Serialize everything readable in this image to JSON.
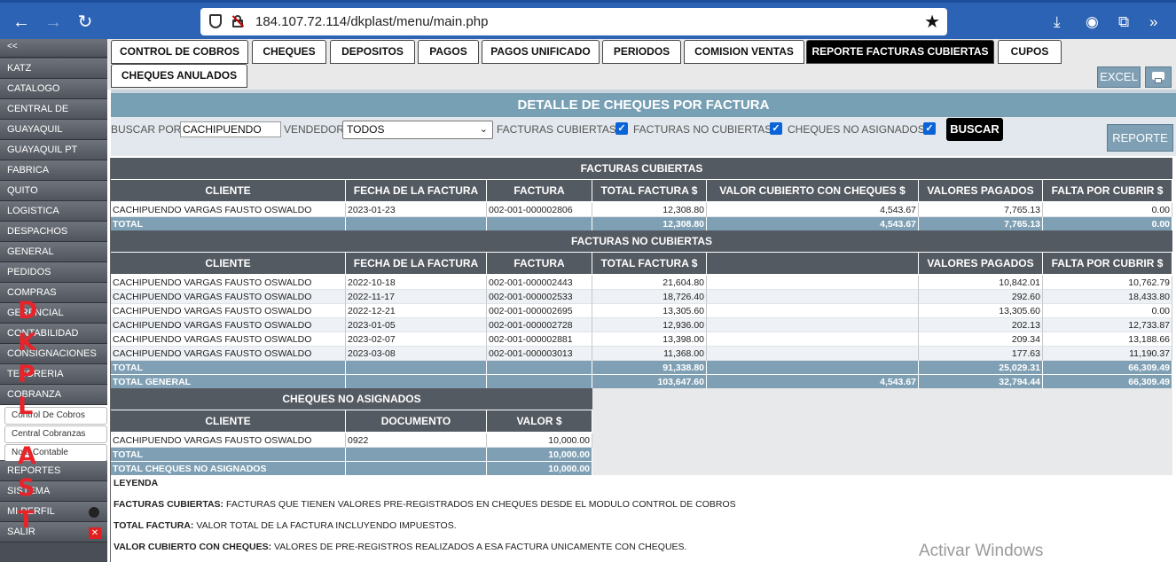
{
  "browser": {
    "url": "184.107.72.114/dkplast/menu/main.php"
  },
  "sidebar": {
    "collapse_label": "<<",
    "items": [
      "KATZ",
      "CATALOGO",
      "CENTRAL DE COSTOS",
      "GUAYAQUIL",
      "GUAYAQUIL PT",
      "FABRICA",
      "QUITO",
      "LOGISTICA",
      "DESPACHOS",
      "GENERAL",
      "PEDIDOS",
      "COMPRAS",
      "GERENCIAL",
      "CONTABILIDAD",
      "CONSIGNACIONES",
      "TESORERIA",
      "COBRANZA"
    ],
    "sub_items": [
      "Control De Cobros",
      "Central Cobranzas",
      "Nota Contable"
    ],
    "bottom_items": [
      "REPORTES",
      "SISTEMA",
      "MI PERFIL",
      "SALIR"
    ],
    "logo_letters": [
      "D",
      "K",
      "P",
      "L",
      "A",
      "S",
      "T"
    ]
  },
  "tabs": [
    "CONTROL DE COBROS",
    "CHEQUES",
    "DEPOSITOS",
    "PAGOS",
    "PAGOS UNIFICADO",
    "PERIODOS",
    "COMISION VENTAS",
    "REPORTE FACTURAS CUBIERTAS",
    "CUPOS",
    "CHEQUES ANULADOS"
  ],
  "toolbar": {
    "excel_label": "EXCEL"
  },
  "page_title": "DETALLE DE CHEQUES POR FACTURA",
  "filters": {
    "buscar_por_label": "BUSCAR POR:",
    "buscar_por_value": "CACHIPUENDO",
    "vendedor_label": "VENDEDOR:",
    "vendedor_value": "TODOS",
    "cb1_label": "FACTURAS CUBIERTAS",
    "cb2_label": "FACTURAS NO CUBIERTAS",
    "cb3_label": "CHEQUES NO ASIGNADOS",
    "buscar_label": "BUSCAR",
    "reporte_label": "REPORTE"
  },
  "cubiertas": {
    "title": "FACTURAS CUBIERTAS",
    "headers": [
      "CLIENTE",
      "FECHA DE LA FACTURA",
      "FACTURA",
      "TOTAL FACTURA $",
      "VALOR CUBIERTO CON CHEQUES $",
      "VALORES PAGADOS",
      "FALTA POR CUBRIR $"
    ],
    "rows": [
      [
        "CACHIPUENDO VARGAS FAUSTO OSWALDO",
        "2023-01-23",
        "002-001-000002806",
        "12,308.80",
        "4,543.67",
        "7,765.13",
        "0.00"
      ]
    ],
    "total": [
      "TOTAL",
      "",
      "",
      "12,308.80",
      "4,543.67",
      "7,765.13",
      "0.00"
    ]
  },
  "no_cubiertas": {
    "title": "FACTURAS NO CUBIERTAS",
    "headers": [
      "CLIENTE",
      "FECHA DE LA FACTURA",
      "FACTURA",
      "TOTAL FACTURA $",
      "",
      "VALORES PAGADOS",
      "FALTA POR CUBRIR $"
    ],
    "rows": [
      [
        "CACHIPUENDO VARGAS FAUSTO OSWALDO",
        "2022-10-18",
        "002-001-000002443",
        "21,604.80",
        "",
        "10,842.01",
        "10,762.79"
      ],
      [
        "CACHIPUENDO VARGAS FAUSTO OSWALDO",
        "2022-11-17",
        "002-001-000002533",
        "18,726.40",
        "",
        "292.60",
        "18,433.80"
      ],
      [
        "CACHIPUENDO VARGAS FAUSTO OSWALDO",
        "2022-12-21",
        "002-001-000002695",
        "13,305.60",
        "",
        "13,305.60",
        "0.00"
      ],
      [
        "CACHIPUENDO VARGAS FAUSTO OSWALDO",
        "2023-01-05",
        "002-001-000002728",
        "12,936.00",
        "",
        "202.13",
        "12,733.87"
      ],
      [
        "CACHIPUENDO VARGAS FAUSTO OSWALDO",
        "2023-02-07",
        "002-001-000002881",
        "13,398.00",
        "",
        "209.34",
        "13,188.66"
      ],
      [
        "CACHIPUENDO VARGAS FAUSTO OSWALDO",
        "2023-03-08",
        "002-001-000003013",
        "11,368.00",
        "",
        "177.63",
        "11,190.37"
      ]
    ],
    "total": [
      "TOTAL",
      "",
      "",
      "91,338.80",
      "",
      "25,029.31",
      "66,309.49"
    ],
    "total_general": [
      "TOTAL GENERAL",
      "",
      "",
      "103,647.60",
      "4,543.67",
      "32,794.44",
      "66,309.49"
    ]
  },
  "no_asignados": {
    "title": "CHEQUES NO ASIGNADOS",
    "headers": [
      "CLIENTE",
      "DOCUMENTO",
      "VALOR $"
    ],
    "rows": [
      [
        "CACHIPUENDO VARGAS FAUSTO OSWALDO",
        "0922",
        "10,000.00"
      ]
    ],
    "total": [
      "TOTAL",
      "",
      "10,000.00"
    ],
    "total_cheques": [
      "TOTAL CHEQUES NO ASIGNADOS",
      "",
      "10,000.00"
    ]
  },
  "leyenda": {
    "title": "LEYENDA",
    "items": [
      {
        "term": "FACTURAS CUBIERTAS:",
        "desc": " FACTURAS QUE TIENEN VALORES PRE-REGISTRADOS EN CHEQUES DESDE EL MODULO CONTROL DE COBROS"
      },
      {
        "term": "TOTAL FACTURA:",
        "desc": " VALOR TOTAL DE LA FACTURA INCLUYENDO IMPUESTOS."
      },
      {
        "term": "VALOR CUBIERTO CON CHEQUES:",
        "desc": " VALORES DE PRE-REGISTROS REALIZADOS A ESA FACTURA UNICAMENTE CON CHEQUES."
      }
    ]
  },
  "watermark": "Activar Windows"
}
